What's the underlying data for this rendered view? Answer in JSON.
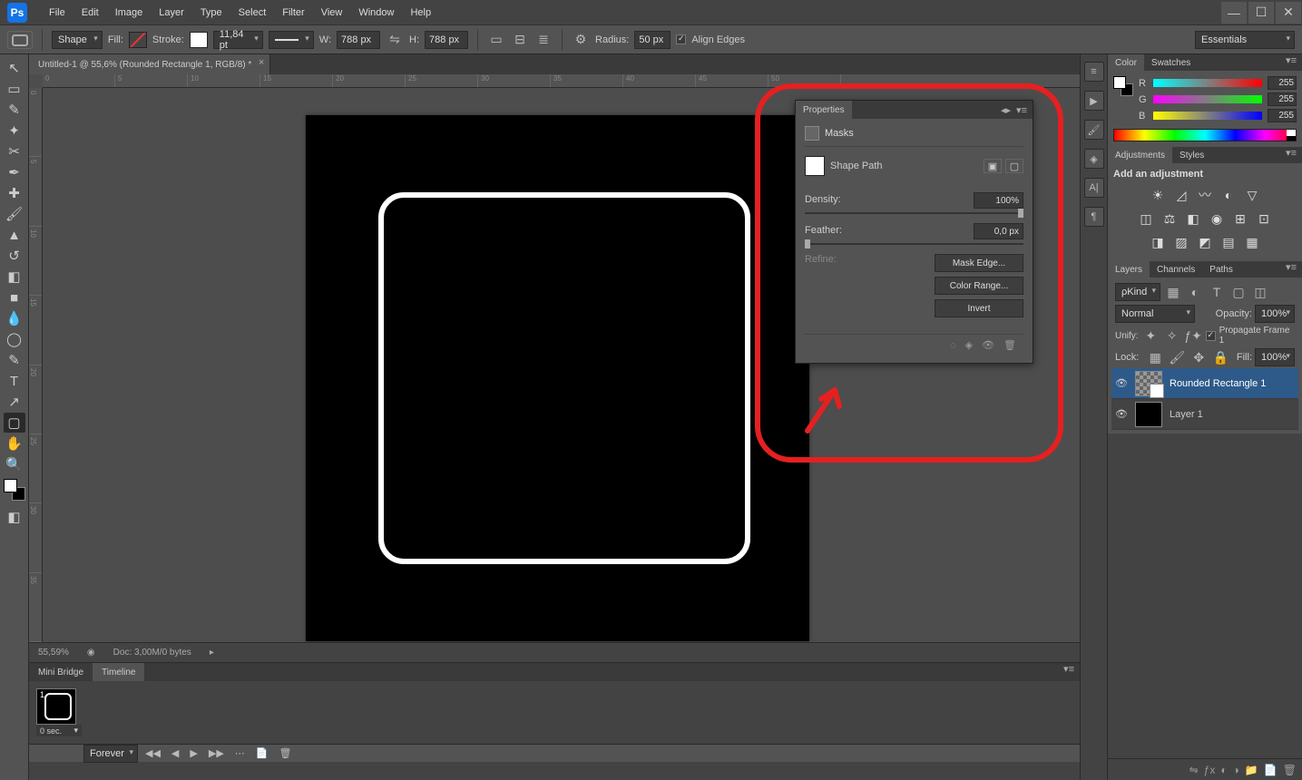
{
  "menu": [
    "File",
    "Edit",
    "Image",
    "Layer",
    "Type",
    "Select",
    "Filter",
    "View",
    "Window",
    "Help"
  ],
  "workspace": "Essentials",
  "options": {
    "mode": "Shape",
    "fill_label": "Fill:",
    "stroke_label": "Stroke:",
    "stroke_pt": "11,84 pt",
    "w_label": "W:",
    "w_val": "788 px",
    "h_label": "H:",
    "h_val": "788 px",
    "radius_label": "Radius:",
    "radius_val": "50 px",
    "align_edges": "Align Edges"
  },
  "doc_tab": "Untitled-1 @ 55,6% (Rounded Rectangle 1, RGB/8) *",
  "ruler_h": [
    "0",
    "5",
    "10",
    "15",
    "20",
    "25",
    "30",
    "35",
    "40",
    "45",
    "50"
  ],
  "ruler_v": [
    "0",
    "5",
    "10",
    "15",
    "20",
    "25",
    "30",
    "35"
  ],
  "status": {
    "zoom": "55,59%",
    "doc": "Doc: 3,00M/0 bytes"
  },
  "bottom_tabs": [
    "Mini Bridge",
    "Timeline"
  ],
  "timeline": {
    "frame_label": "0 sec.",
    "forever": "Forever"
  },
  "properties": {
    "tab": "Properties",
    "masks": "Masks",
    "shape_path": "Shape Path",
    "density_label": "Density:",
    "density_val": "100%",
    "feather_label": "Feather:",
    "feather_val": "0,0 px",
    "refine_label": "Refine:",
    "mask_edge": "Mask Edge...",
    "color_range": "Color Range...",
    "invert": "Invert"
  },
  "color": {
    "r": "255",
    "g": "255",
    "b": "255",
    "r_label": "R",
    "g_label": "G",
    "b_label": "B",
    "tabs": [
      "Color",
      "Swatches"
    ]
  },
  "adjustments": {
    "tabs": [
      "Adjustments",
      "Styles"
    ],
    "title": "Add an adjustment"
  },
  "layers": {
    "tabs": [
      "Layers",
      "Channels",
      "Paths"
    ],
    "kind": "Kind",
    "blend": "Normal",
    "opacity_label": "Opacity:",
    "opacity_val": "100%",
    "unify_label": "Unify:",
    "propagate": "Propagate Frame 1",
    "lock_label": "Lock:",
    "fill_label": "Fill:",
    "fill_val": "100%",
    "items": [
      {
        "name": "Rounded Rectangle 1"
      },
      {
        "name": "Layer 1"
      }
    ]
  }
}
